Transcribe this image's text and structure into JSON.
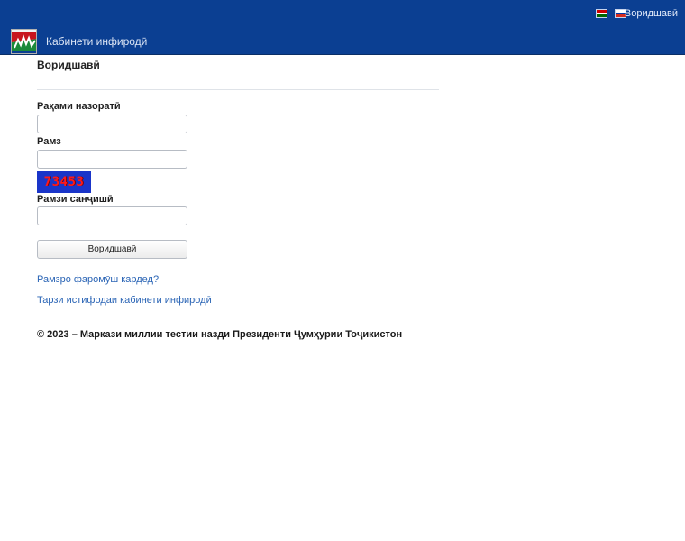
{
  "topbar": {
    "languages": [
      {
        "code": "tg",
        "colors": [
          "#cc0000",
          "#ffffff",
          "#006600"
        ]
      },
      {
        "code": "ru",
        "colors": [
          "#ffffff",
          "#0039a6",
          "#d52b1e"
        ]
      }
    ],
    "login_link": "Воридшавӣ"
  },
  "navbar": {
    "brand": "Кабинети инфиродӣ"
  },
  "login": {
    "title": "Воридшавӣ",
    "control_number_label": "Рақами назоратӣ",
    "control_number_value": "",
    "password_label": "Рамз",
    "password_value": "",
    "captcha_text": "73453",
    "check_code_label": "Рамзи санҷишӣ",
    "check_code_value": "",
    "submit_label": "Воридшавӣ",
    "forgot_password_link": "Рамзро фаромӯш кардед?",
    "usage_guide_link": "Тарзи истифодаи кабинети инфиродӣ"
  },
  "footer": {
    "copyright": "© 2023 – Маркази миллии тестии назди Президенти Ҷумҳурии Тоҷикистон"
  },
  "colors": {
    "header_bg": "#0b3f92",
    "link": "#2a64b5",
    "captcha_bg": "#1a35c9",
    "captcha_text": "#ff1a1a"
  }
}
